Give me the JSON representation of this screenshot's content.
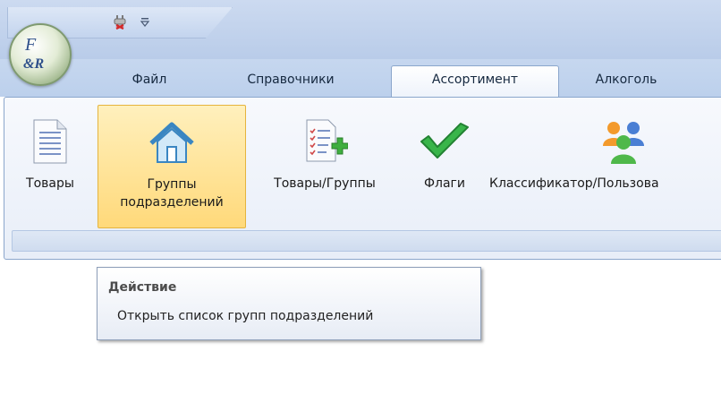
{
  "app": {
    "logo_text": "&R"
  },
  "tabs": [
    {
      "label": "Файл"
    },
    {
      "label": "Справочники"
    },
    {
      "label": "Ассортимент",
      "active": true
    },
    {
      "label": "Алкоголь"
    }
  ],
  "ribbon": {
    "buttons": [
      {
        "label": "Товары",
        "icon": "document-list-icon"
      },
      {
        "label": "Группы подразделений",
        "icon": "house-icon",
        "highlighted": true
      },
      {
        "label": "Товары/Группы",
        "icon": "checklist-add-icon"
      },
      {
        "label": "Флаги",
        "icon": "checkmark-icon"
      },
      {
        "label": "Классификатор/Пользова",
        "icon": "users-group-icon"
      }
    ]
  },
  "tooltip": {
    "title": "Действие",
    "text": "Открыть список групп подразделений"
  },
  "colors": {
    "accent": "#bcd0ec",
    "highlight": "#ffd97a"
  }
}
